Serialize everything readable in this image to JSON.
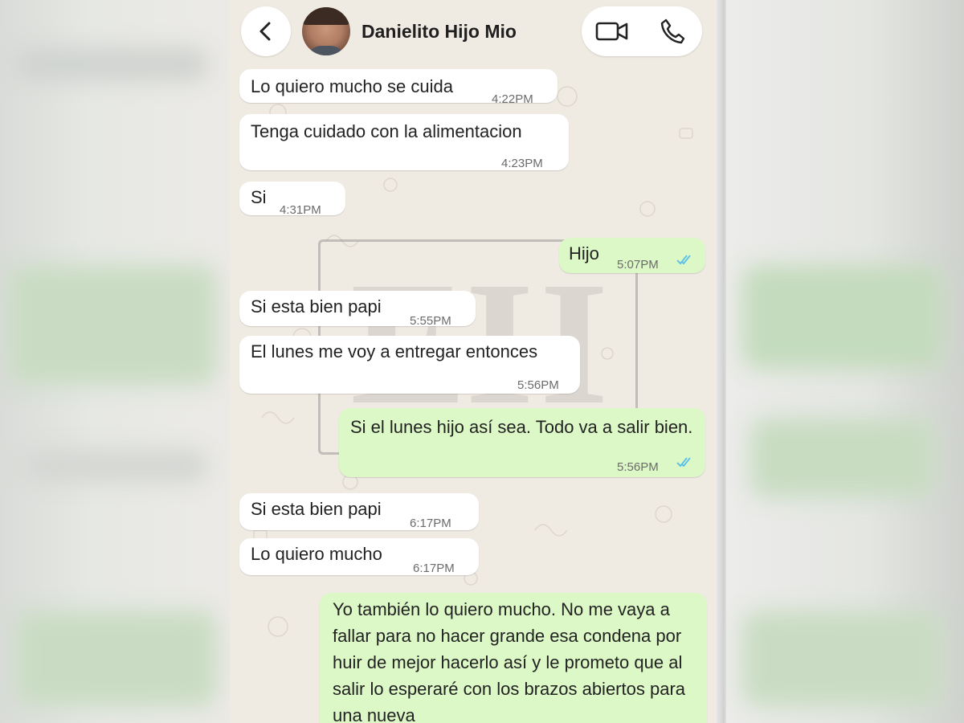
{
  "header": {
    "back_icon": "chevron-left-icon",
    "contact_name": "Danielito Hijo Mio",
    "video_call_icon": "video-camera-icon",
    "voice_call_icon": "phone-icon"
  },
  "messages": [
    {
      "direction": "incoming",
      "text": "Lo quiero mucho se cuida",
      "time": "4:22PM"
    },
    {
      "direction": "incoming",
      "text": "Tenga cuidado con la alimentacion",
      "time": "4:23PM"
    },
    {
      "direction": "incoming",
      "text": "Si",
      "time": "4:31PM"
    },
    {
      "direction": "outgoing",
      "text": "Hijo",
      "time": "5:07PM",
      "status": "read"
    },
    {
      "direction": "incoming",
      "text": "Si esta bien papi",
      "time": "5:55PM"
    },
    {
      "direction": "incoming",
      "text": "El lunes me voy a entregar entonces",
      "time": "5:56PM"
    },
    {
      "direction": "outgoing",
      "text": "Si el lunes hijo así sea.  Todo va a salir bien.",
      "time": "5:56PM",
      "status": "read"
    },
    {
      "direction": "incoming",
      "text": "Si esta bien papi",
      "time": "6:17PM"
    },
    {
      "direction": "incoming",
      "text": "Lo quiero mucho",
      "time": "6:17PM"
    },
    {
      "direction": "outgoing",
      "text": "Yo también lo quiero mucho. No me vaya a fallar para no hacer grande esa condena por huir de mejor hacerlo así y le prometo que al salir lo esperaré con los brazos abiertos para una nueva",
      "time": ""
    }
  ],
  "colors": {
    "incoming_bubble": "#ffffff",
    "outgoing_bubble": "#dcf8c6",
    "chat_background": "#efeae2",
    "read_ticks": "#53bdeb"
  },
  "watermark": {
    "letters": "EH"
  }
}
